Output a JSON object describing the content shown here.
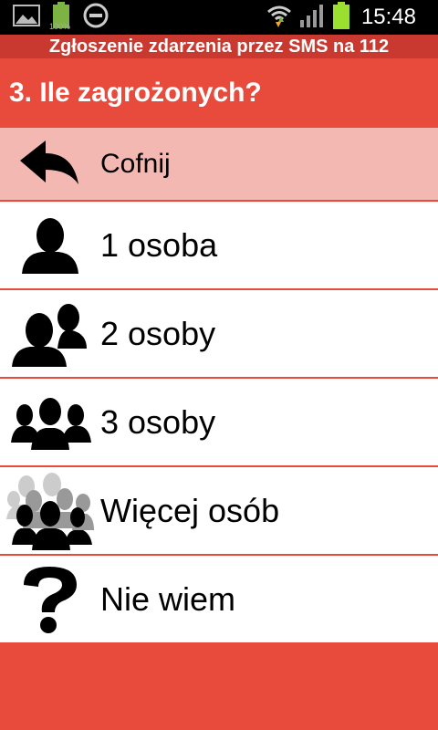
{
  "status_bar": {
    "time": "15:48",
    "battery_label": "100%"
  },
  "app_title": "Zgłoszenie zdarzenia przez SMS na 112",
  "question": "3. Ile zagrożonych?",
  "options": [
    {
      "label": "Cofnij",
      "icon": "back-arrow-icon"
    },
    {
      "label": "1 osoba",
      "icon": "person-icon"
    },
    {
      "label": "2 osoby",
      "icon": "two-persons-icon"
    },
    {
      "label": "3 osoby",
      "icon": "three-persons-icon"
    },
    {
      "label": "Więcej osób",
      "icon": "crowd-icon"
    },
    {
      "label": "Nie wiem",
      "icon": "question-mark-icon"
    }
  ],
  "colors": {
    "accent": "#e84a3c",
    "title_bar": "#c9392f",
    "back_row": "#f4b8b2"
  }
}
